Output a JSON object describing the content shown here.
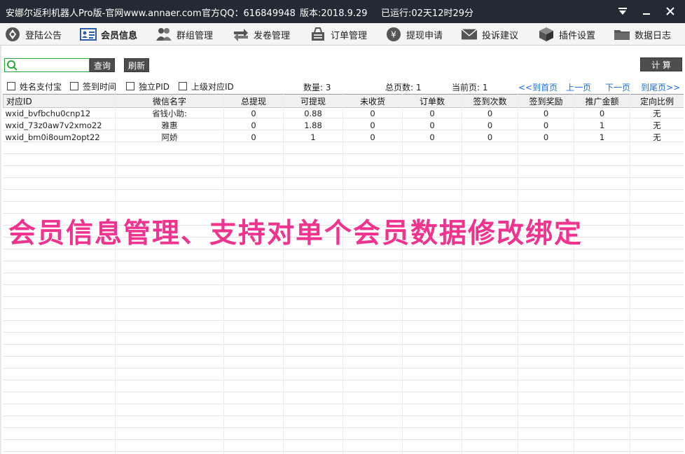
{
  "window": {
    "title": "安娜尔返利机器人Pro版-官网www.annaer.com",
    "qq": "官方QQ：616849948",
    "version": "版本:2018.9.29",
    "uptime": "已运行:02天12时29分"
  },
  "nav": {
    "items": [
      {
        "label": "登陆公告",
        "icon": "login-icon"
      },
      {
        "label": "会员信息",
        "icon": "member-card-icon"
      },
      {
        "label": "群组管理",
        "icon": "group-icon"
      },
      {
        "label": "发卷管理",
        "icon": "exchange-icon"
      },
      {
        "label": "订单管理",
        "icon": "cart-icon"
      },
      {
        "label": "提现申请",
        "icon": "yen-icon"
      },
      {
        "label": "投诉建议",
        "icon": "mail-icon"
      },
      {
        "label": "插件设置",
        "icon": "cube-icon"
      },
      {
        "label": "数据日志",
        "icon": "folder-icon"
      }
    ]
  },
  "toolbar": {
    "search_placeholder": "",
    "search_value": "",
    "query_label": "查询",
    "refresh_label": "刷新",
    "calc_label": "计 算"
  },
  "filters": {
    "name_alipay": "姓名支付宝",
    "sign_time": "签到时间",
    "independent_pid": "独立PID",
    "parent_id": "上级对应ID"
  },
  "stats": {
    "count": "数量: 3",
    "total_pages": "总页数: 1",
    "current_page": "当前页: 1"
  },
  "pager": {
    "first": "<<到首页",
    "prev": "上一页",
    "next": "下一页",
    "last": "到尾页>>"
  },
  "table": {
    "headers": [
      "对应ID",
      "微信名字",
      "总提现",
      "可提现",
      "未收货",
      "订单数",
      "签到次数",
      "签到奖励",
      "推广金额",
      "定向比例"
    ],
    "rows": [
      [
        "wxid_bvfbchu0cnp12",
        "省钱小助:",
        "0",
        "0.88",
        "0",
        "0",
        "0",
        "0",
        "0",
        "无"
      ],
      [
        "wxid_73z0aw7v2xmo22",
        "雅惠",
        "0",
        "1.88",
        "0",
        "0",
        "0",
        "0",
        "1",
        "无"
      ],
      [
        "wxid_bm0i8oum2opt22",
        "阿娇",
        "0",
        "1",
        "0",
        "0",
        "0",
        "0",
        "1",
        "无"
      ]
    ]
  },
  "caption": "会员信息管理、支持对单个会员数据修改绑定",
  "colors": {
    "titlebar": "#242a33",
    "caption": "#f0338f",
    "link": "#1a6ed8",
    "search_border": "#2aa53a"
  }
}
